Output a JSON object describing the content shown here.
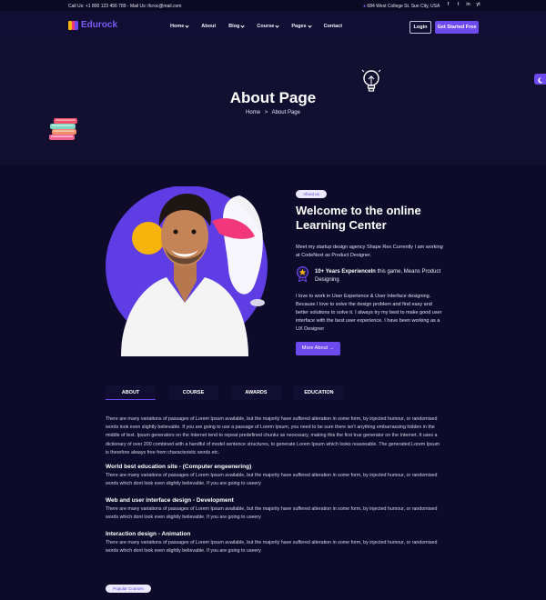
{
  "topbar": {
    "contact": "Call Us: +1 800 123 456 789 - Mail Us: ifcroc@mail.com",
    "address": "684 West College St. Sun City, USA",
    "social": [
      "f",
      "t",
      "in",
      "yt"
    ]
  },
  "nav": {
    "logo": "Edurock",
    "items": [
      "Home",
      "About",
      "Blog",
      "Course",
      "Pages",
      "Contact"
    ],
    "login": "Login",
    "cta": "Get Started Free"
  },
  "hero": {
    "title": "About Page",
    "crumb_home": "Home",
    "crumb_sep": ">",
    "crumb_current": "About Page"
  },
  "about": {
    "badge": "About us",
    "heading": "Welcome to the online Learning Center",
    "intro": "Meet my startup design agency Shape Rex Currently I am working at CodeNext as Product Designer.",
    "exp_strong": "10+ Years ExperienceIn",
    "exp_rest": " this game, Means Product Designing",
    "body": "I love to work in User Experience & User Interface designing. Because I love to solve the design problem and find easy and better solutions to solve it. I always try my best to make good user interface with the best user experience. I have been working as a UX Designer",
    "button": "More About →"
  },
  "tabs": [
    "ABOUT",
    "COURSE",
    "AWARDS",
    "EDUCATION"
  ],
  "tab_content": {
    "intro": "There are many variations of passages of Lorem Ipsum available, but the majority have suffered alteration in some form, by injected humour, or randomised words look even slightly believable. If you are going to use a passage of Lorem Ipsum, you need to be sure there isn't anything embarrassing hidden in the middle of text. Ipsum generators on the Internet tend to repeat predefined chunks as necessary, making this the first true generator on the Internet. It uses a dictionary of over 200 combined with a handful of model sentence structures, to generate Lorem Ipsum which looks reasonable. The generated Lorem Ipsum is therefore always free from characteristic words etc.",
    "sections": [
      {
        "title": "World best education site - (Computer engeenering)",
        "text": "There are many variations of passages of Lorem Ipsum available, but the majority have suffered alteration in some form, by injected humour, or randomised words which dont look even slightly believable. If you are going to useery"
      },
      {
        "title": "Web and user interface design - Development",
        "text": "There are many variations of passages of Lorem Ipsum available, but the majority have suffered alteration in some form, by injected humour, or randomised words which dont look even slightly believable. If you are going to useery"
      },
      {
        "title": "Interaction design - Animation",
        "text": "There are many variations of passages of Lorem Ipsum available, but the majority have suffered alteration in some form, by injected humour, or randomised words which dont look even slightly believable. If you are going to useery"
      }
    ]
  },
  "popular_badge": "Popular Courses",
  "colors": {
    "accent": "#6d4aed",
    "background": "#0e0b2a",
    "badge_bg": "#ece8ff",
    "shape_yellow": "#f6b40b",
    "shape_pink": "#f2387a"
  },
  "icons": [
    "location-icon",
    "facebook-icon",
    "twitter-icon",
    "instagram-icon",
    "youtube-icon",
    "lightbulb-icon",
    "books-icon",
    "moon-icon",
    "award-icon"
  ]
}
